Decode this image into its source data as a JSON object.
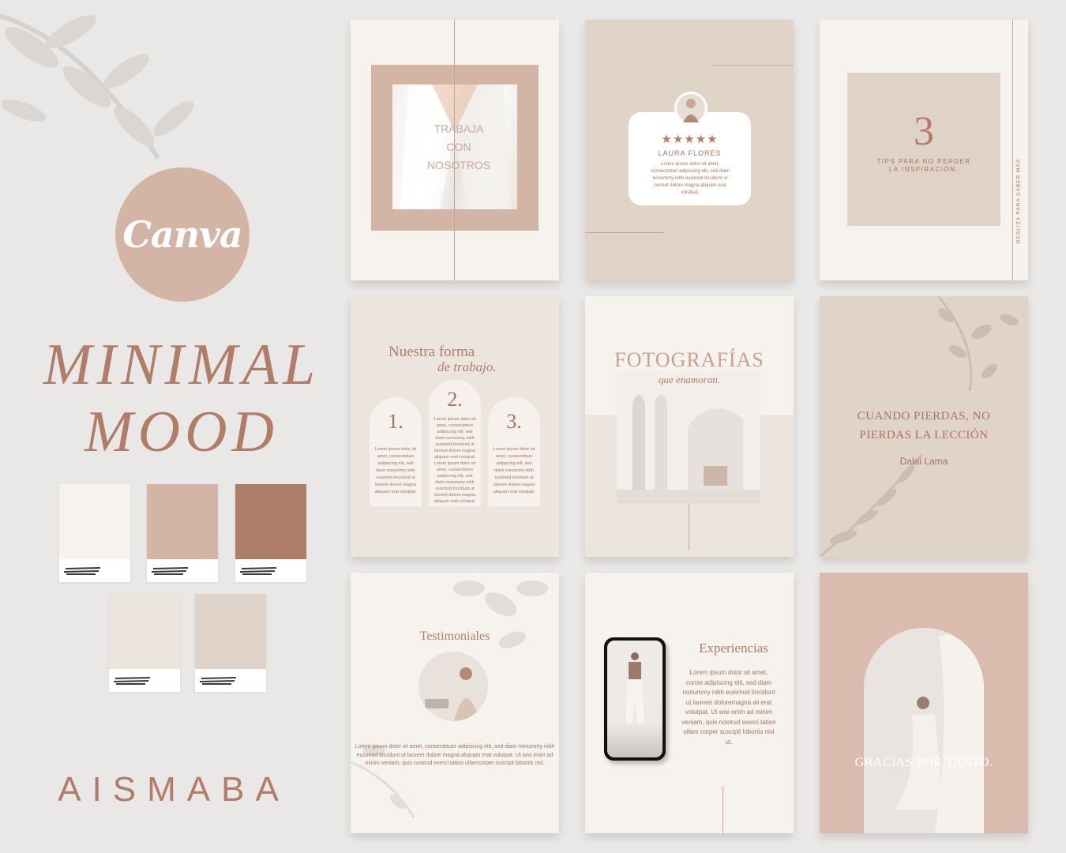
{
  "brand": {
    "logo_text": "Canva",
    "title_line1": "MINIMAL",
    "title_line2": "MOOD",
    "author": "AISMABA"
  },
  "palette": [
    "#f6f3ee",
    "#d3b5a6",
    "#ae7e68",
    "#ece5de",
    "#dfd3c9"
  ],
  "cards": {
    "c1": {
      "text": "TRABAJA CON NOSOTROS"
    },
    "c2": {
      "stars": "★★★★★",
      "name": "LAURA FLORES",
      "body": "Lorem ipsum dolor sit amet, consectetuer adipiscing elit, sed diam nonummy nibh euismod tincidunt ut laoreet dolore magna aliquam erat volutpat."
    },
    "c3": {
      "number": "3",
      "tip": "TIPS PARA NO PERDER LA INSPIRACIÓN.",
      "side": "DESLIZA PARA SABER MÁS"
    },
    "c4": {
      "title_a": "Nuestra forma",
      "title_b": "de trabajo.",
      "steps": [
        {
          "num": "1.",
          "text": "Lorem ipsum dolor sit amet, consectetuer adipiscing elit, sed diam nonummy nibh euismod tincidunt ut laoreet dolore magna aliquam erat volutpat."
        },
        {
          "num": "2.",
          "text": "Lorem ipsum dolor sit amet, consectetuer adipiscing elit, sed diam nonummy nibh euismod tincidunt ut laoreet dolore magna aliquam erat volutpat. Lorem ipsum dolor sit amet, consectetuer adipiscing elit, sed diam nonummy nibh euismod tincidunt ut laoreet dolore magna aliquam erat volutpat."
        },
        {
          "num": "3.",
          "text": "Lorem ipsum dolor sit amet, consectetuer adipiscing elit, sed diam nonummy nibh euismod tincidunt ut laoreet dolore magna aliquam erat volutpat."
        }
      ]
    },
    "c5": {
      "title": "FOTOGRAFÍAS",
      "subtitle": "que enamoran."
    },
    "c6": {
      "quote": "CUANDO PIERDAS, NO PIERDAS LA LECCIÓN",
      "author": "Dalai Lama"
    },
    "c7": {
      "title": "Testimoniales",
      "body": "Lorem ipsum dolor sit amet, consectetuer adipiscing elit, sed diam nonummy nibh euismod tincidunt ut laoreet dolore magna aliquam erat volutpat. Ut wisi enim ad minim veniam, quis nostrud exerci tation ullamcorper suscipit lobortis nisl."
    },
    "c8": {
      "title": "Experiencias",
      "body": "Lorem ipsum dolor sit amet, conse adipiscing elit, sed diam nonummy nibh euismod tincidunt ut laoreet doloremagna ali erat volutpat. Ut wisi enim ad minim veniam, quis nostrud exerci tation ullam corper suscipit lobortis nisl ut."
    },
    "c9": {
      "text": "GRACIAS POR TANTO."
    }
  }
}
